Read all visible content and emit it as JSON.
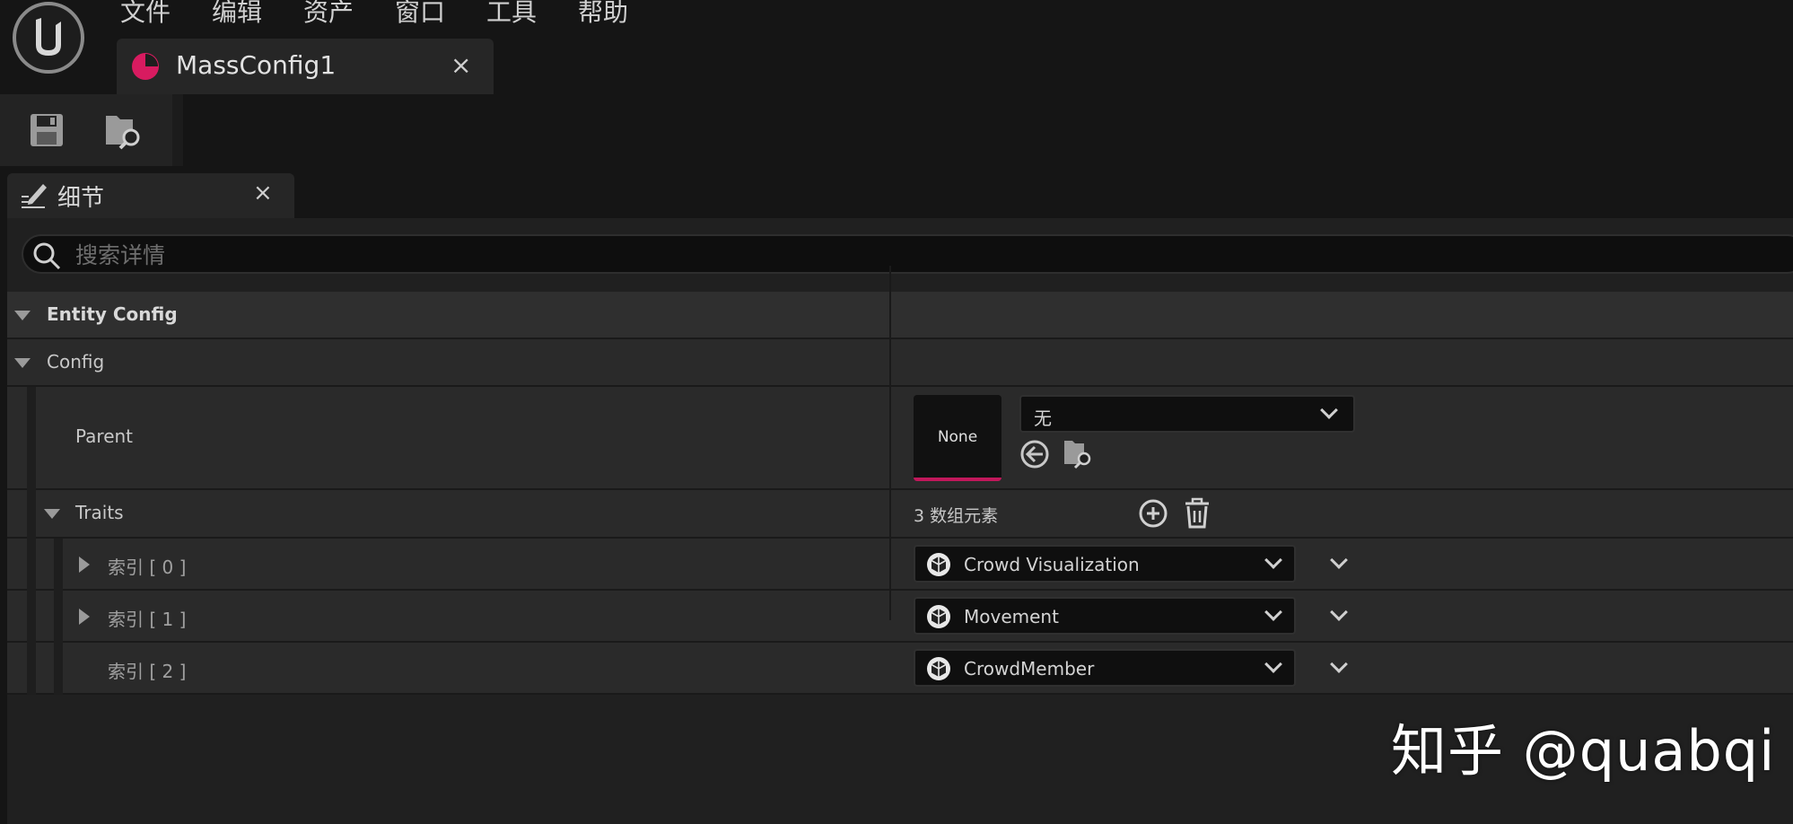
{
  "menu": [
    "文件",
    "编辑",
    "资产",
    "窗口",
    "工具",
    "帮助"
  ],
  "doc_tab": {
    "label": "MassConfig1",
    "close": "×"
  },
  "details_tab": {
    "label": "细节",
    "close": "×"
  },
  "search": {
    "placeholder": "搜索详情"
  },
  "sections": {
    "entity_config": "Entity Config",
    "config": "Config"
  },
  "parent": {
    "label": "Parent",
    "thumbnail": "None",
    "value": "无"
  },
  "traits": {
    "label": "Traits",
    "count": "3 数组元素",
    "items": [
      {
        "index": "索引 [ 0 ]",
        "value": "Crowd Visualization",
        "expandable": true
      },
      {
        "index": "索引 [ 1 ]",
        "value": "Movement",
        "expandable": true
      },
      {
        "index": "索引 [ 2 ]",
        "value": "CrowdMember",
        "expandable": false
      }
    ]
  },
  "watermark": "知乎 @quabqi",
  "colors": {
    "accent": "#c2185b",
    "background": "#151515",
    "panel": "#202020",
    "row": "#2a2a2a"
  }
}
